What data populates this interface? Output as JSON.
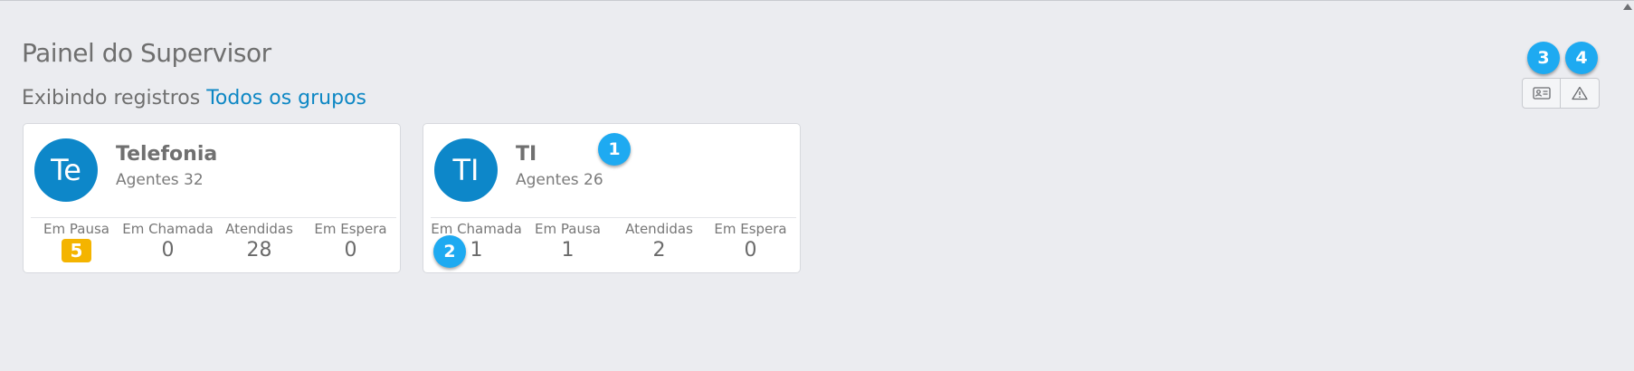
{
  "page": {
    "title": "Painel do Supervisor",
    "subtitle_prefix": "Exibindo registros",
    "subtitle_link": "Todos os grupos"
  },
  "groups": [
    {
      "avatar": "Te",
      "name": "Telefonia",
      "agents": "Agentes 32",
      "stats": [
        {
          "label": "Em Pausa",
          "value": "5"
        },
        {
          "label": "Em Chamada",
          "value": "0"
        },
        {
          "label": "Atendidas",
          "value": "28"
        },
        {
          "label": "Em Espera",
          "value": "0"
        }
      ]
    },
    {
      "avatar": "TI",
      "name": "TI",
      "agents": "Agentes 26",
      "stats": [
        {
          "label": "Em Chamada",
          "value": "1"
        },
        {
          "label": "Em Pausa",
          "value": "1"
        },
        {
          "label": "Atendidas",
          "value": "2"
        },
        {
          "label": "Em Espera",
          "value": "0"
        }
      ]
    }
  ],
  "markers": [
    "1",
    "2",
    "3",
    "4"
  ],
  "toolbar": {
    "buttons": [
      {
        "icon": "id-card-icon"
      },
      {
        "icon": "warning-triangle-icon"
      }
    ]
  },
  "colors": {
    "accent": "#0d87c9",
    "link": "#0d87c4",
    "pause_badge": "#f4b400",
    "marker": "#1eaaf1",
    "background": "#ebecf0"
  }
}
